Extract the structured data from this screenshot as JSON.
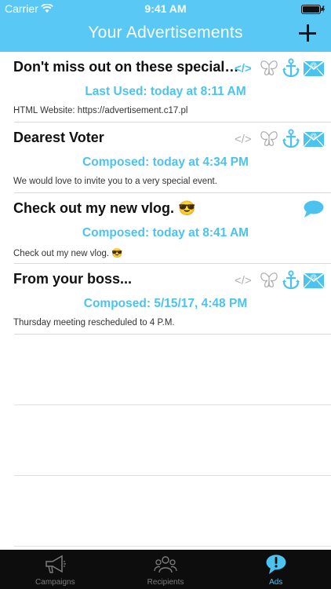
{
  "status_bar": {
    "carrier": "Carrier",
    "time": "9:41 AM"
  },
  "nav": {
    "title": "Your Advertisements"
  },
  "colors": {
    "accent": "#5ac8f5",
    "status_text": "#4cc3ef",
    "icon_inactive": "#b0b0b0"
  },
  "ads": [
    {
      "title": "Don't miss out on these special o...",
      "status": "Last Used: today at 8:11 AM",
      "preview": "HTML Website: https://advertisement.c17.pl",
      "icons": [
        "html-code-icon",
        "butterfly-icon",
        "anchor-icon",
        "email-icon"
      ],
      "active_icons": [
        "html-code-icon",
        "anchor-icon",
        "email-icon"
      ]
    },
    {
      "title": "Dearest Voter",
      "status": "Composed: today at 4:34 PM",
      "preview": "We would love to invite you to a very special event.",
      "icons": [
        "html-code-icon",
        "butterfly-icon",
        "anchor-icon",
        "email-icon"
      ],
      "active_icons": [
        "anchor-icon",
        "email-icon"
      ]
    },
    {
      "title": "Check out my new vlog. 😎",
      "status": "Composed: today at 8:41 AM",
      "preview": "Check out my new vlog. 😎",
      "icons": [
        "chat-bubble-icon"
      ],
      "active_icons": [
        "chat-bubble-icon"
      ]
    },
    {
      "title": "From your boss...",
      "status": "Composed: 5/15/17, 4:48 PM",
      "preview": "Thursday meeting rescheduled to 4 P.M.",
      "icons": [
        "html-code-icon",
        "butterfly-icon",
        "anchor-icon",
        "email-icon"
      ],
      "active_icons": [
        "anchor-icon",
        "email-icon"
      ]
    }
  ],
  "tabs": [
    {
      "label": "Campaigns",
      "icon": "megaphone-icon",
      "active": false
    },
    {
      "label": "Recipients",
      "icon": "people-icon",
      "active": false
    },
    {
      "label": "Ads",
      "icon": "ads-bubble-icon",
      "active": true
    }
  ]
}
